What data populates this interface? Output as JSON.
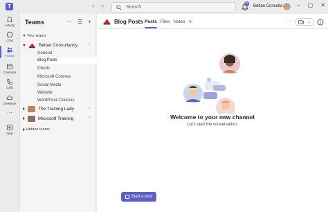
{
  "topbar": {
    "logo_letter": "T",
    "back_icon": "‹",
    "forward_icon": "›",
    "search_placeholder": "Search",
    "notification_count": "5",
    "org_name": "Beltan Consultan...",
    "more_icon": "···",
    "minimize_icon": "–",
    "maximize_icon": "▢",
    "close_icon": "✕"
  },
  "rail": {
    "items": [
      {
        "label": "Activity",
        "icon": "bell-icon"
      },
      {
        "label": "Chat",
        "icon": "chat-icon"
      },
      {
        "label": "Teams",
        "icon": "teams-icon"
      },
      {
        "label": "Calendar",
        "icon": "calendar-icon"
      },
      {
        "label": "Calls",
        "icon": "phone-icon"
      },
      {
        "label": "OneDrive",
        "icon": "cloud-icon"
      },
      {
        "label": "Apps",
        "icon": "apps-icon"
      }
    ],
    "more": "···"
  },
  "panel": {
    "title": "Teams",
    "more": "···",
    "filter_icon": "☰",
    "add_icon": "+",
    "section_your_teams": "Your teams",
    "teams": [
      {
        "name": "Beltan Consultancy",
        "color": "#ffffff",
        "more": "···"
      },
      {
        "name": "The Training Lady",
        "color": "#b8856a",
        "more": "···"
      },
      {
        "name": "Microsoft Training",
        "color": "#8d6e63",
        "more": "···"
      }
    ],
    "channels": [
      "General",
      "Blog Posts",
      "Clients",
      "Microsoft Courses",
      "Social Media",
      "Website",
      "WordPress Courses"
    ],
    "hidden_teams": "Hidden teams"
  },
  "main": {
    "channel_title": "Blog Posts",
    "tabs": [
      "Posts",
      "Files",
      "Notes"
    ],
    "add_tab": "+",
    "more": "···",
    "welcome": "Welcome to your new channel",
    "subwelcome": "Let's start the conversation.",
    "start_post": "Start a post"
  },
  "colors": {
    "accent": "#5b5fc7",
    "background": "#ebebeb",
    "panel": "#f5f5f5",
    "content": "#ffffff"
  }
}
